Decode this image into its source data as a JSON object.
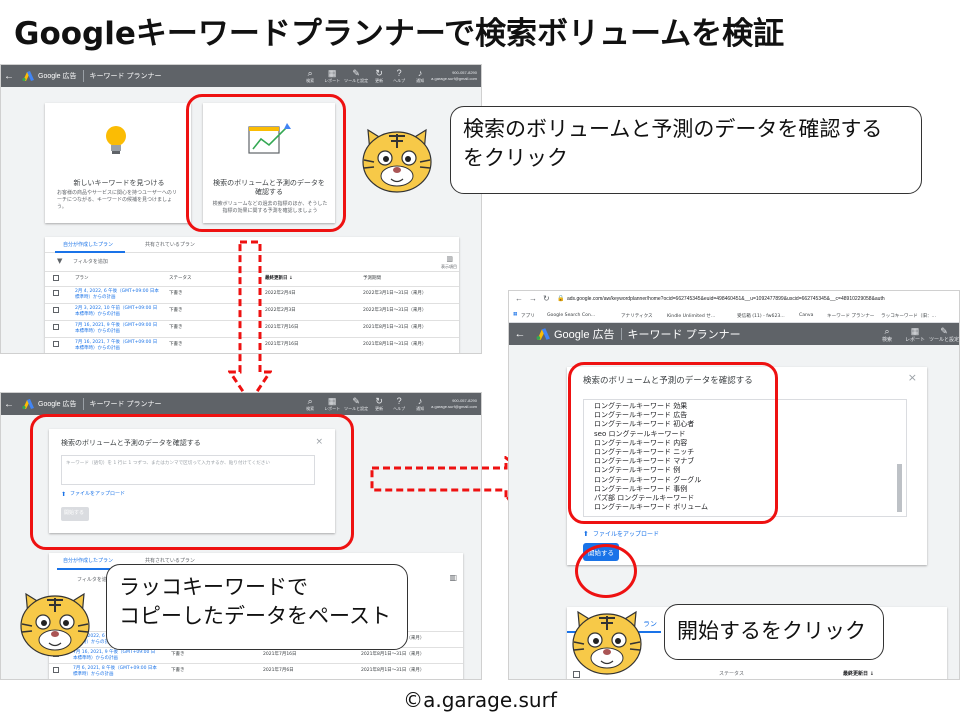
{
  "title": "Googleキーワードプランナーで検索ボリュームを検証",
  "copyright": "©a.garage.surf",
  "gads": {
    "brand": "Google 広告",
    "tool": "キーワード プランナー",
    "tools": [
      "検索",
      "レポート",
      "ツールと設定",
      "更新",
      "ヘルプ",
      "通知"
    ],
    "account_id": "900-057-8290",
    "account_email": "a.garage.surf@gmail.com"
  },
  "panel1": {
    "card_new_title": "新しいキーワードを見つける",
    "card_new_desc": "お客様の商品やサービスに関心を持つユーザーへのリーチにつながる、キーワードの候補を見つけましょう。",
    "card_forecast_title": "検索のボリュームと予測のデータを確認する",
    "card_forecast_desc": "検索ボリュームなどの過去の指標のほか、そうした指標の効果に関する予測を確認しましょう",
    "tab_mine": "自分が作成したプラン",
    "tab_shared": "共有されているプラン",
    "filter": "フィルタを追加",
    "columns_label": "表示項目",
    "headers": [
      "プラン",
      "ステータス",
      "最終更新日 ↓",
      "予測期間"
    ],
    "rows": [
      {
        "plan": "2月 4, 2022, 6 午後（GMT+09:00 日本標準時）からの計画",
        "status": "下書き",
        "updated": "2022年2月4日",
        "period": "2022年3月1日～31日（来月）"
      },
      {
        "plan": "2月 3, 2022, 10 午前（GMT+09:00 日本標準時）からの計画",
        "status": "下書き",
        "updated": "2022年2月3日",
        "period": "2022年3月1日～31日（来月）"
      },
      {
        "plan": "7月 16, 2021, 9 午後（GMT+09:00 日本標準時）からの計画",
        "status": "下書き",
        "updated": "2021年7月16日",
        "period": "2021年8月1日～31日（来月）"
      },
      {
        "plan": "7月 16, 2021, 7 午後（GMT+09:00 日本標準時）からの計画",
        "status": "下書き",
        "updated": "2021年7月16日",
        "period": "2021年8月1日～31日（来月）"
      }
    ]
  },
  "bubble1": "検索のボリュームと予測のデータを確認する\nをクリック",
  "panel2": {
    "dialog_title": "検索のボリュームと予測のデータを確認する",
    "placeholder": "キーワード（語句）を 1 行に 1 つずつ、またはカンマで区切って入力するか、貼り付けてください",
    "upload": "ファイルをアップロード",
    "start": "開始する",
    "tab_mine": "自分が作成したプラン",
    "tab_shared": "共有されているプラン",
    "filter": "フィルタを追加",
    "rows": [
      {
        "plan": "2月 4, 2022, 6 午後（GMT+09:00 日本標準時）からの計画",
        "status": "下書き",
        "updated": "2022年2月4日",
        "period": "2022年3月1日～31日（来月）"
      },
      {
        "plan": "7月 16, 2021, 9 午後（GMT+09:00 日本標準時）からの計画",
        "status": "下書き",
        "updated": "2021年7月16日",
        "period": "2021年8月1日～31日（来月）"
      },
      {
        "plan": "7月 6, 2021, 8 午後（GMT+09:00 日本標準時）からの計画",
        "status": "下書き",
        "updated": "2021年7月6日",
        "period": "2021年8月1日～31日（来月）"
      }
    ]
  },
  "bubble2": "ラッコキーワードで\nコピーしたデータをペースト",
  "panel3": {
    "url": "ads.google.com/aw/keywordplanner/home?ocid=662745345&euid=498460451&__u=1092477899&uscid=662745345&__c=48910229058&auth",
    "bookmarks": [
      "アプリ",
      "Google Search Con...",
      "アナリティクス",
      "Kindle Unlimited せ...",
      "受信箱 (11) - fw623...",
      "Canva",
      "キーワード プランナー",
      "ラッコキーワード（旧：..."
    ],
    "dialog_title": "検索のボリュームと予測のデータを確認する",
    "keywords": [
      "ロングテールキーワード 効果",
      "ロングテールキーワード 広告",
      "ロングテールキーワード 初心者",
      "seo ロングテールキーワード",
      "ロングテールキーワード 内容",
      "ロングテールキーワード ニッチ",
      "ロングテールキーワード マナブ",
      "ロングテールキーワード 例",
      "ロングテールキーワード グーグル",
      "ロングテールキーワード 事例",
      "パズ部 ロングテールキーワード",
      "ロングテールキーワード ボリューム"
    ],
    "upload": "ファイルをアップロード",
    "start": "開始する",
    "tab_fragment": "ラン",
    "status_header": "ステータス",
    "updated_header": "最終更新日 ↓"
  },
  "bubble3": "開始するをクリック",
  "colors": {
    "red": "#ee1111",
    "topbar": "#5f6368",
    "link": "#1a73e8",
    "button": "#1a73e8"
  }
}
